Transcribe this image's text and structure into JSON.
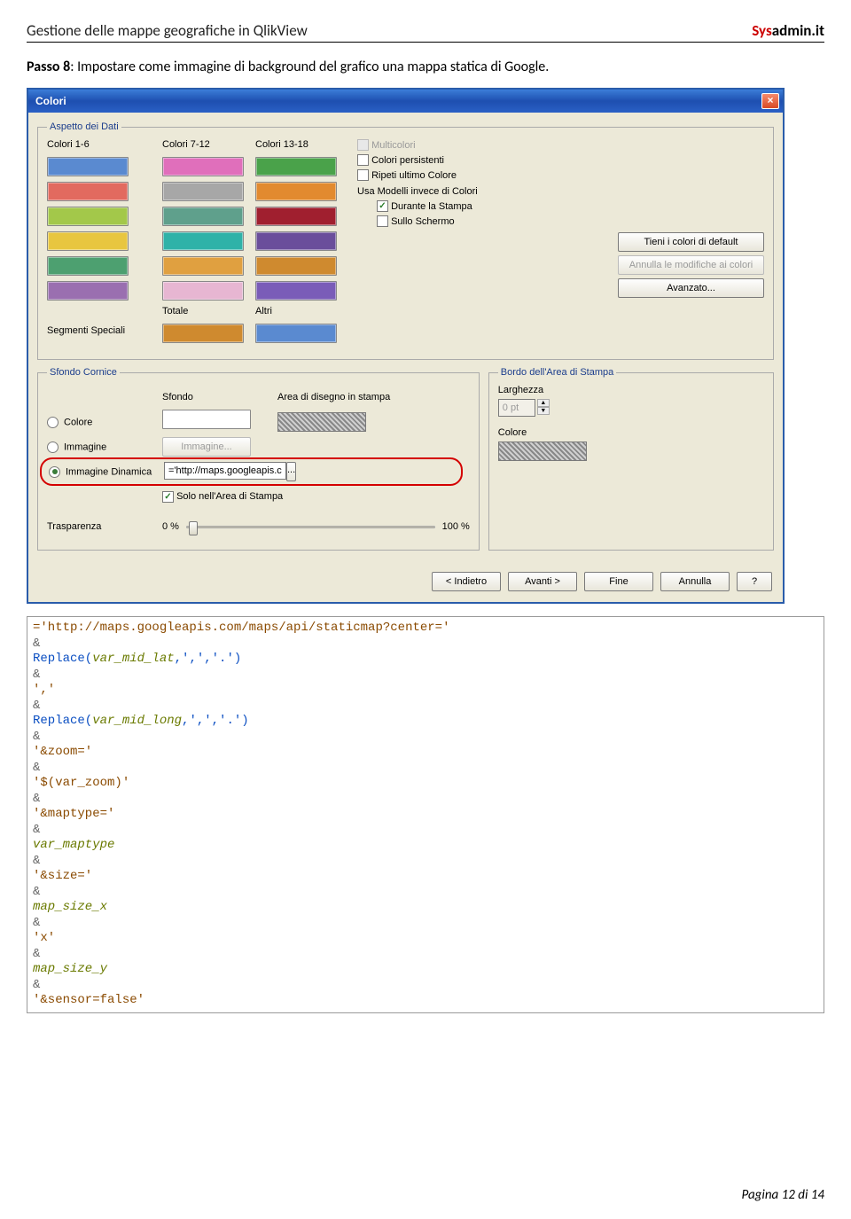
{
  "header": {
    "left": "Gestione delle mappe geografiche in QlikView",
    "right_sys": "Sys",
    "right_admin": "admin",
    "right_suffix": ".it"
  },
  "intro": {
    "label": "Passo 8",
    "text": ": Impostare come immagine di background del grafico una mappa statica di Google."
  },
  "dialog": {
    "title": "Colori",
    "group_aspetto": "Aspetto dei Dati",
    "col1": "Colori 1-6",
    "col2": "Colori 7-12",
    "col3": "Colori 13-18",
    "chk_multi": "Multicolori",
    "chk_persist": "Colori persistenti",
    "chk_repeat": "Ripeti ultimo Colore",
    "models_lbl": "Usa Modelli invece di Colori",
    "chk_print": "Durante la Stampa",
    "chk_screen": "Sullo Schermo",
    "btn_default": "Tieni i colori di default",
    "btn_undo": "Annulla le modifiche ai colori",
    "btn_adv": "Avanzato...",
    "lbl_segmenti": "Segmenti Speciali",
    "lbl_totale": "Totale",
    "lbl_altri": "Altri",
    "group_sfondo": "Sfondo Cornice",
    "group_bordo": "Bordo dell'Area di Stampa",
    "c_sfondo": "Sfondo",
    "c_area": "Area di disegno in stampa",
    "r_colore": "Colore",
    "r_img": "Immagine",
    "r_dyn": "Immagine Dinamica",
    "btn_img": "Immagine...",
    "inp_dyn": "='http://maps.googleapis.co",
    "chk_stampa": "Solo nell'Area di Stampa",
    "lbl_trasp": "Trasparenza",
    "pct0": "0 %",
    "pct100": "100 %",
    "lbl_larg": "Larghezza",
    "spin_val": "0 pt",
    "lbl_colore": "Colore",
    "btn_back": "< Indietro",
    "btn_next": "Avanti >",
    "btn_end": "Fine",
    "btn_cancel": "Annulla",
    "btn_help": "?"
  },
  "colors": {
    "c1": [
      "#5a8ad0",
      "#e26a5f",
      "#a3c84a",
      "#e8c63f",
      "#4da070",
      "#9a6fb0"
    ],
    "c2": [
      "#e06fbb",
      "#a7a7a7",
      "#5fa08c",
      "#2fb2a8",
      "#e0a040",
      "#e7b6d2"
    ],
    "c3": [
      "#4aa24a",
      "#e28a2f",
      "#a01f2f",
      "#6a4e9b",
      "#cf8a2f",
      "#7a5cb8"
    ],
    "totale": "#cf8a2f",
    "altri": "#5a8ad0"
  },
  "code": {
    "l1": "='http://maps.googleapis.com/maps/api/staticmap?center='",
    "amp": "&",
    "rep1a": "Replace(",
    "rep1b": "var_mid_lat",
    "rep1c": ",',','.')",
    "comma": "','",
    "rep2a": "Replace(",
    "rep2b": "var_mid_long",
    "rep2c": ",',','.')",
    "zoom": "'&zoom='",
    "zoomv": "'$(var_zoom)'",
    "maptype": "'&maptype='",
    "maptypev": "var_maptype",
    "size": "'&size='",
    "msx": "map_size_x",
    "xlit": "'x'",
    "msy": "map_size_y",
    "sensor": "'&sensor=false'"
  },
  "footer": {
    "prefix": "Pagina ",
    "val": "12 di 14"
  }
}
